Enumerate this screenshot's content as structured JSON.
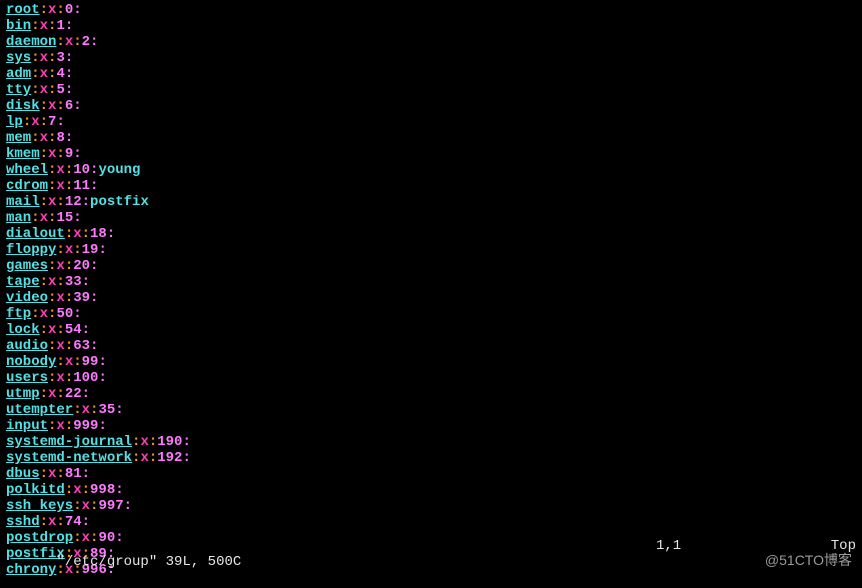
{
  "lines": [
    {
      "name": "root",
      "x": "x",
      "gid": "0",
      "members": ""
    },
    {
      "name": "bin",
      "x": "x",
      "gid": "1",
      "members": ""
    },
    {
      "name": "daemon",
      "x": "x",
      "gid": "2",
      "members": ""
    },
    {
      "name": "sys",
      "x": "x",
      "gid": "3",
      "members": ""
    },
    {
      "name": "adm",
      "x": "x",
      "gid": "4",
      "members": ""
    },
    {
      "name": "tty",
      "x": "x",
      "gid": "5",
      "members": ""
    },
    {
      "name": "disk",
      "x": "x",
      "gid": "6",
      "members": ""
    },
    {
      "name": "lp",
      "x": "x",
      "gid": "7",
      "members": ""
    },
    {
      "name": "mem",
      "x": "x",
      "gid": "8",
      "members": ""
    },
    {
      "name": "kmem",
      "x": "x",
      "gid": "9",
      "members": ""
    },
    {
      "name": "wheel",
      "x": "x",
      "gid": "10",
      "members": "young"
    },
    {
      "name": "cdrom",
      "x": "x",
      "gid": "11",
      "members": ""
    },
    {
      "name": "mail",
      "x": "x",
      "gid": "12",
      "members": "postfix"
    },
    {
      "name": "man",
      "x": "x",
      "gid": "15",
      "members": ""
    },
    {
      "name": "dialout",
      "x": "x",
      "gid": "18",
      "members": ""
    },
    {
      "name": "floppy",
      "x": "x",
      "gid": "19",
      "members": ""
    },
    {
      "name": "games",
      "x": "x",
      "gid": "20",
      "members": ""
    },
    {
      "name": "tape",
      "x": "x",
      "gid": "33",
      "members": ""
    },
    {
      "name": "video",
      "x": "x",
      "gid": "39",
      "members": ""
    },
    {
      "name": "ftp",
      "x": "x",
      "gid": "50",
      "members": ""
    },
    {
      "name": "lock",
      "x": "x",
      "gid": "54",
      "members": ""
    },
    {
      "name": "audio",
      "x": "x",
      "gid": "63",
      "members": ""
    },
    {
      "name": "nobody",
      "x": "x",
      "gid": "99",
      "members": ""
    },
    {
      "name": "users",
      "x": "x",
      "gid": "100",
      "members": ""
    },
    {
      "name": "utmp",
      "x": "x",
      "gid": "22",
      "members": ""
    },
    {
      "name": "utempter",
      "x": "x",
      "gid": "35",
      "members": ""
    },
    {
      "name": "input",
      "x": "x",
      "gid": "999",
      "members": ""
    },
    {
      "name": "systemd-journal",
      "x": "x",
      "gid": "190",
      "members": ""
    },
    {
      "name": "systemd-network",
      "x": "x",
      "gid": "192",
      "members": ""
    },
    {
      "name": "dbus",
      "x": "x",
      "gid": "81",
      "members": ""
    },
    {
      "name": "polkitd",
      "x": "x",
      "gid": "998",
      "members": ""
    },
    {
      "name": "ssh_keys",
      "x": "x",
      "gid": "997",
      "members": ""
    },
    {
      "name": "sshd",
      "x": "x",
      "gid": "74",
      "members": ""
    },
    {
      "name": "postdrop",
      "x": "x",
      "gid": "90",
      "members": ""
    },
    {
      "name": "postfix",
      "x": "x",
      "gid": "89",
      "members": ""
    },
    {
      "name": "chrony",
      "x": "x",
      "gid": "996",
      "members": ""
    }
  ],
  "status": {
    "filename": "\"/etc/group\"",
    "info": "39L, 500C",
    "position": "1,1",
    "scroll": "Top"
  },
  "watermark": "@51CTO博客"
}
